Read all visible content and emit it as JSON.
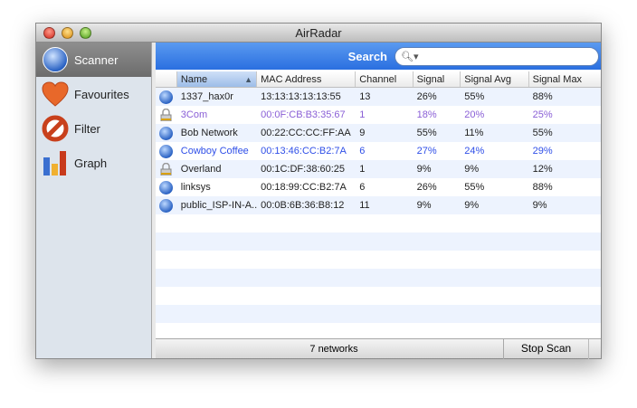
{
  "window": {
    "title": "AirRadar"
  },
  "sidebar": {
    "items": [
      {
        "label": "Scanner",
        "icon": "globe-icon"
      },
      {
        "label": "Favourites",
        "icon": "heart-icon"
      },
      {
        "label": "Filter",
        "icon": "prohibited-icon"
      },
      {
        "label": "Graph",
        "icon": "bar-graph-icon"
      }
    ]
  },
  "search": {
    "label": "Search",
    "value": ""
  },
  "table": {
    "columns": [
      "Name",
      "MAC Address",
      "Channel",
      "Signal",
      "Signal Avg",
      "Signal Max"
    ],
    "rows": [
      {
        "icon": "globe",
        "name": "1337_hax0r",
        "mac": "13:13:13:13:13:55",
        "channel": "13",
        "signal": "26%",
        "avg": "55%",
        "max": "88%",
        "color": "#222222"
      },
      {
        "icon": "lock",
        "name": "3Com",
        "mac": "00:0F:CB:B3:35:67",
        "channel": "1",
        "signal": "18%",
        "avg": "20%",
        "max": "25%",
        "color": "#8a5fd6"
      },
      {
        "icon": "globe",
        "name": "Bob Network",
        "mac": "00:22:CC:CC:FF:AA",
        "channel": "9",
        "signal": "55%",
        "avg": "11%",
        "max": "55%",
        "color": "#222222"
      },
      {
        "icon": "globe",
        "name": "Cowboy Coffee",
        "mac": "00:13:46:CC:B2:7A",
        "channel": "6",
        "signal": "27%",
        "avg": "24%",
        "max": "29%",
        "color": "#2f4fe8"
      },
      {
        "icon": "lock",
        "name": "Overland",
        "mac": "00:1C:DF:38:60:25",
        "channel": "1",
        "signal": "9%",
        "avg": "9%",
        "max": "12%",
        "color": "#222222"
      },
      {
        "icon": "globe",
        "name": "linksys",
        "mac": "00:18:99:CC:B2:7A",
        "channel": "6",
        "signal": "26%",
        "avg": "55%",
        "max": "88%",
        "color": "#222222"
      },
      {
        "icon": "globe",
        "name": "public_ISP-IN-A...",
        "mac": "00:0B:6B:36:B8:12",
        "channel": "11",
        "signal": "9%",
        "avg": "9%",
        "max": "9%",
        "color": "#222222"
      }
    ]
  },
  "footer": {
    "count": "7 networks",
    "stop_button": "Stop Scan"
  }
}
